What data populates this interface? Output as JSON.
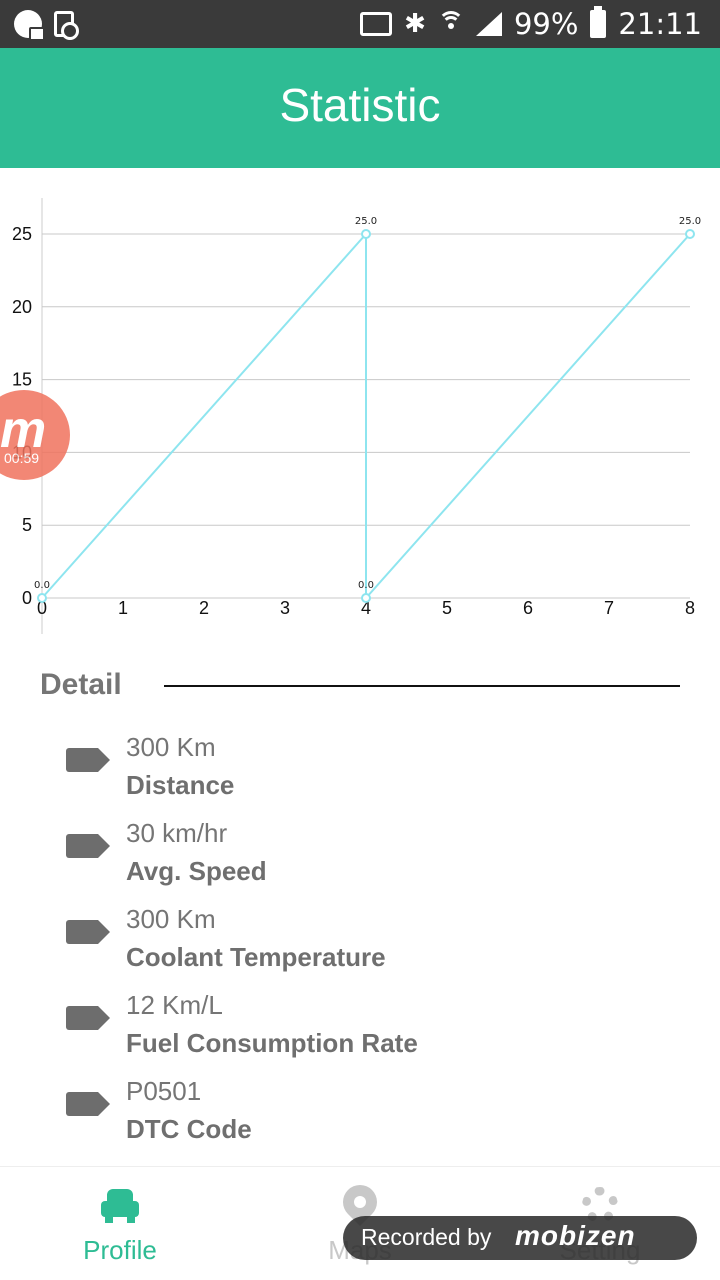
{
  "status_bar": {
    "battery": "99%",
    "time": "21:11"
  },
  "app_bar": {
    "title": "Statistic"
  },
  "chart_data": {
    "type": "line",
    "x": [
      0,
      4,
      4,
      8
    ],
    "y": [
      0.0,
      25.0,
      0.0,
      25.0
    ],
    "point_labels": [
      "0.0",
      "25.0",
      "0.0",
      "25.0"
    ],
    "x_ticks": [
      "0",
      "1",
      "2",
      "3",
      "4",
      "5",
      "6",
      "7",
      "8"
    ],
    "y_ticks": [
      "0",
      "5",
      "10",
      "15",
      "20",
      "25"
    ],
    "xlim": [
      0,
      8
    ],
    "ylim": [
      0,
      25
    ],
    "grid": "horizontal",
    "line_color": "#8ee5ef"
  },
  "record_bubble": {
    "timer": "00:59"
  },
  "detail": {
    "title": "Detail",
    "items": [
      {
        "value": "300 Km",
        "label": "Distance"
      },
      {
        "value": "30 km/hr",
        "label": "Avg. Speed"
      },
      {
        "value": "300 Km",
        "label": "Coolant Temperature"
      },
      {
        "value": "12 Km/L",
        "label": "Fuel Consumption Rate"
      },
      {
        "value": "P0501",
        "label": "DTC Code"
      }
    ]
  },
  "bottom_nav": {
    "items": [
      {
        "label": "Profile",
        "icon": "car-icon",
        "active": true
      },
      {
        "label": "Maps",
        "icon": "map-pin-icon",
        "active": false
      },
      {
        "label": "Setting",
        "icon": "gear-icon",
        "active": false
      }
    ]
  },
  "recorder_banner": {
    "text": "Recorded by",
    "brand": "mobizen"
  },
  "colors": {
    "accent": "#2ebc94",
    "status_bar": "#3a3a3a",
    "inactive": "#c8c8c8"
  }
}
